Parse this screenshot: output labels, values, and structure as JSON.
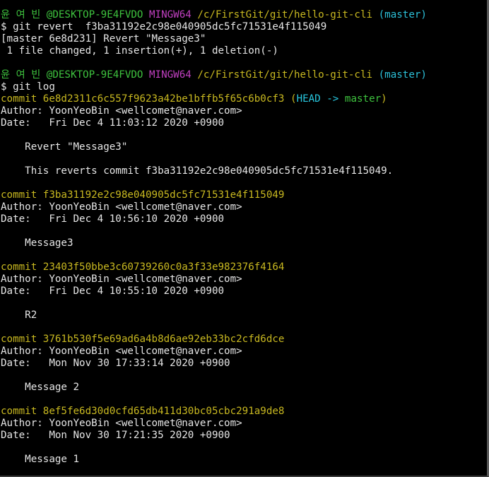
{
  "prompt": {
    "user_host": "윤 여 빈 @DESKTOP-9E4FVDO",
    "shell": "MINGW64",
    "path": "/c/FirstGit/git/hello-git-cli",
    "branch": "(master)",
    "symbol": "$"
  },
  "block1": {
    "command": "git revert  f3ba31192e2c98e040905dc5fc71531e4f115049",
    "out1": "[master 6e8d231] Revert \"Message3\"",
    "out2": " 1 file changed, 1 insertion(+), 1 deletion(-)"
  },
  "block2": {
    "command": "git log"
  },
  "commits": [
    {
      "label": "commit",
      "hash": "6e8d2311c6c557f9623a42be1bffb5f65c6b0cf3",
      "refs_open": "(",
      "refs_head": "HEAD -> ",
      "refs_branch": "master",
      "refs_close": ")",
      "author": "Author: YoonYeoBin <wellcomet@naver.com>",
      "date": "Date:   Fri Dec 4 11:03:12 2020 +0900",
      "message": "    Revert \"Message3\"",
      "body": "    This reverts commit f3ba31192e2c98e040905dc5fc71531e4f115049."
    },
    {
      "label": "commit",
      "hash": "f3ba31192e2c98e040905dc5fc71531e4f115049",
      "author": "Author: YoonYeoBin <wellcomet@naver.com>",
      "date": "Date:   Fri Dec 4 10:56:10 2020 +0900",
      "message": "    Message3"
    },
    {
      "label": "commit",
      "hash": "23403f50bbe3c60739260c0a3f33e982376f4164",
      "author": "Author: YoonYeoBin <wellcomet@naver.com>",
      "date": "Date:   Fri Dec 4 10:55:10 2020 +0900",
      "message": "    R2"
    },
    {
      "label": "commit",
      "hash": "3761b530f5e69ad6a4b8d6ae92eb33bc2cfd6dce",
      "author": "Author: YoonYeoBin <wellcomet@naver.com>",
      "date": "Date:   Mon Nov 30 17:33:14 2020 +0900",
      "message": "    Message 2"
    },
    {
      "label": "commit",
      "hash": "8ef5fe6d30d0cfd65db411d30bc05cbc291a9de8",
      "author": "Author: YoonYeoBin <wellcomet@naver.com>",
      "date": "Date:   Mon Nov 30 17:21:35 2020 +0900",
      "message": "    Message 1"
    }
  ],
  "colors": {
    "background": "#000000",
    "text": "#e6e6e6",
    "user_host": "#3ec23e",
    "shell": "#c040c0",
    "path": "#c8b820",
    "branch": "#2cc0d8",
    "commit_hash": "#c8b820",
    "head_ref": "#28c8e0",
    "master_ref": "#3ec23e"
  }
}
